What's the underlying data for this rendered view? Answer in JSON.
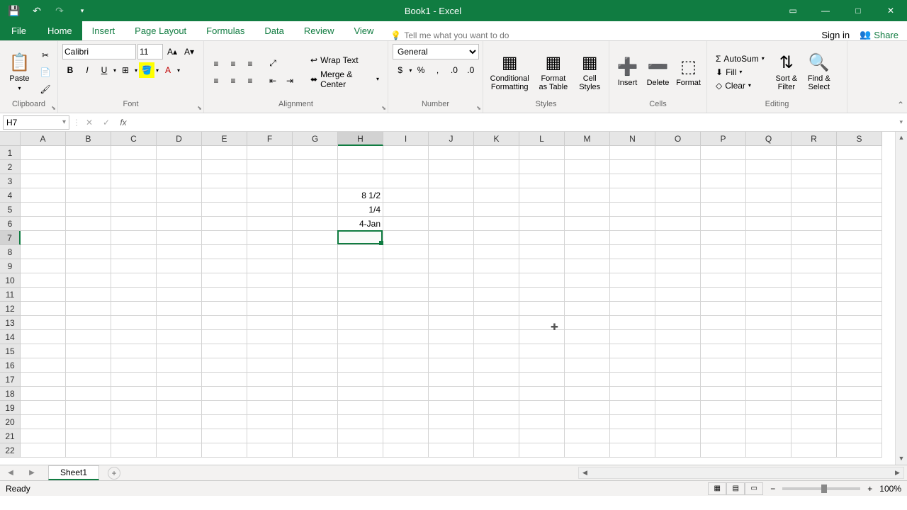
{
  "title": "Book1 - Excel",
  "qat": {
    "save": "save",
    "undo": "undo",
    "redo": "redo"
  },
  "win": {
    "signin": "Sign in",
    "share": "Share"
  },
  "tabs": [
    "File",
    "Home",
    "Insert",
    "Page Layout",
    "Formulas",
    "Data",
    "Review",
    "View"
  ],
  "activeTab": 1,
  "tellme": "Tell me what you want to do",
  "ribbon": {
    "clipboard": {
      "label": "Clipboard",
      "paste": "Paste"
    },
    "font": {
      "label": "Font",
      "name": "Calibri",
      "size": "11",
      "bold": "B",
      "italic": "I",
      "underline": "U"
    },
    "alignment": {
      "label": "Alignment",
      "wrap": "Wrap Text",
      "merge": "Merge & Center"
    },
    "number": {
      "label": "Number",
      "format": "General"
    },
    "styles": {
      "label": "Styles",
      "cond": "Conditional Formatting",
      "table": "Format as Table",
      "cell": "Cell Styles"
    },
    "cells": {
      "label": "Cells",
      "insert": "Insert",
      "delete": "Delete",
      "format": "Format"
    },
    "editing": {
      "label": "Editing",
      "autosum": "AutoSum",
      "fill": "Fill",
      "clear": "Clear",
      "sort": "Sort & Filter",
      "find": "Find & Select"
    }
  },
  "nameBox": "H7",
  "formula": "",
  "columns": [
    "A",
    "B",
    "C",
    "D",
    "E",
    "F",
    "G",
    "H",
    "I",
    "J",
    "K",
    "L",
    "M",
    "N",
    "O",
    "P",
    "Q",
    "R",
    "S"
  ],
  "rowCount": 22,
  "selectedCol": 7,
  "selectedRow": 6,
  "cellData": {
    "H4": "8 1/2",
    "H5": "1/4",
    "H6": "4-Jan"
  },
  "sheet": {
    "name": "Sheet1"
  },
  "status": {
    "ready": "Ready",
    "zoom": "100%"
  }
}
